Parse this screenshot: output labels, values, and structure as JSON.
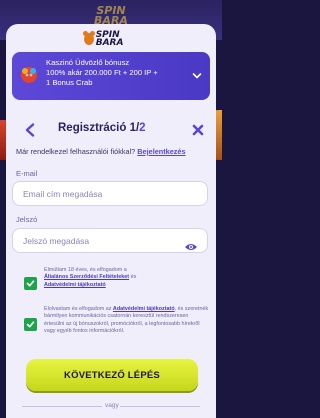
{
  "background": {
    "logo_text": "SPIN BARA"
  },
  "modal": {
    "logo_text": "SPIN BARA",
    "bonus": {
      "title": "Kaszinó Üdvözlő bónusz",
      "line1": "100% akár 200.000 Ft + 200 IP +",
      "line2": "1 Bonus Crab"
    },
    "header": {
      "title": "Regisztráció 1/",
      "step_total": "2"
    },
    "login_prompt": "Már rendelkezel felhasználói fiókkal?",
    "login_link": "Bejelentkezés",
    "email": {
      "label": "E-mail",
      "placeholder": "Email cím megadása"
    },
    "password": {
      "label": "Jelszó",
      "placeholder": "Jelszó megadása"
    },
    "consent1": {
      "prefix": "Elmúltam 18 éves, és elfogadom a",
      "link1": "Általános Szerződési Feltételeket",
      "middle": "és",
      "link2": "Adatvédelmi tájékoztató"
    },
    "consent2": {
      "prefix": "Elolvastam és elfogadom az",
      "link": "Adatvédelmi tájékoztató",
      "suffix": ", és szeretnék bármilyen kommunikációs csatornán keresztül rendszeresen értesülni az új bónuszokról, promóciókról, a legfontosabb hírekről vagy egyéb fontos információkról."
    },
    "cta_label": "KÖVETKEZŐ LÉPÉS",
    "divider_text": "vagy"
  },
  "colors": {
    "accent": "#5a46d6",
    "checkbox": "#1ea34a",
    "cta": "#dbe92f"
  }
}
